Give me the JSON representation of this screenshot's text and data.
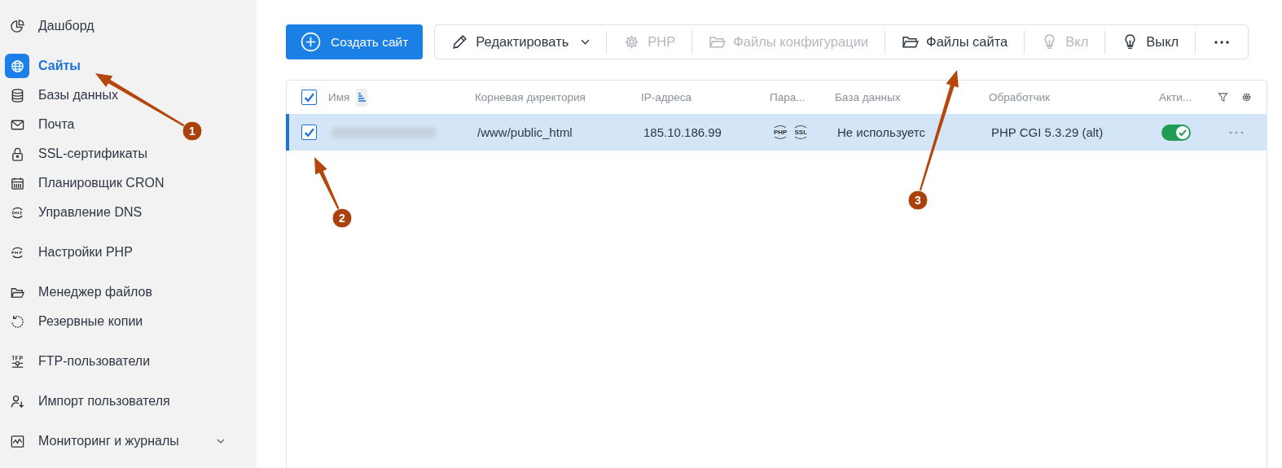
{
  "sidebar": {
    "groups": [
      {
        "items": [
          {
            "label": "Дашборд",
            "selected": false
          }
        ]
      },
      {
        "items": [
          {
            "label": "Сайты",
            "selected": true
          },
          {
            "label": "Базы данных",
            "selected": false
          },
          {
            "label": "Почта",
            "selected": false
          },
          {
            "label": "SSL-сертификаты",
            "selected": false
          },
          {
            "label": "Планировщик CRON",
            "selected": false
          },
          {
            "label": "Управление DNS",
            "selected": false
          }
        ]
      },
      {
        "items": [
          {
            "label": "Настройки PHP",
            "selected": false
          }
        ]
      },
      {
        "items": [
          {
            "label": "Менеджер файлов",
            "selected": false
          },
          {
            "label": "Резервные копии",
            "selected": false
          }
        ]
      },
      {
        "items": [
          {
            "label": "FTP-пользователи",
            "selected": false
          }
        ]
      },
      {
        "items": [
          {
            "label": "Импорт пользователя",
            "selected": false
          }
        ]
      },
      {
        "items": [
          {
            "label": "Мониторинг и журналы",
            "selected": false,
            "expandable": true
          }
        ]
      }
    ]
  },
  "toolbar": {
    "create_button": "Создать сайт",
    "buttons": [
      {
        "label": "Редактировать",
        "disabled": false,
        "dropdown": true
      },
      {
        "label": "PHP",
        "disabled": true,
        "dropdown": false
      },
      {
        "label": "Файлы конфигурации",
        "disabled": true,
        "dropdown": false
      },
      {
        "label": "Файлы сайта",
        "disabled": false,
        "dropdown": false
      },
      {
        "label": "Вкл",
        "disabled": true,
        "dropdown": false
      },
      {
        "label": "Выкл",
        "disabled": false,
        "dropdown": false
      }
    ]
  },
  "table": {
    "header_checked": true,
    "columns": [
      "Имя",
      "Корневая директория",
      "IP-адреса",
      "Пара...",
      "База данных",
      "Обработчик",
      "Акти..."
    ],
    "rows": [
      {
        "selected": true,
        "checked": true,
        "root": "/www/public_html",
        "ip": "185.10.186.99",
        "params": [
          "PHP",
          "SSL"
        ],
        "database": "Не используетс",
        "handler": "PHP CGI 5.3.29 (alt)",
        "active": true
      }
    ]
  },
  "annotations": [
    {
      "number": "1"
    },
    {
      "number": "2"
    },
    {
      "number": "3"
    }
  ]
}
